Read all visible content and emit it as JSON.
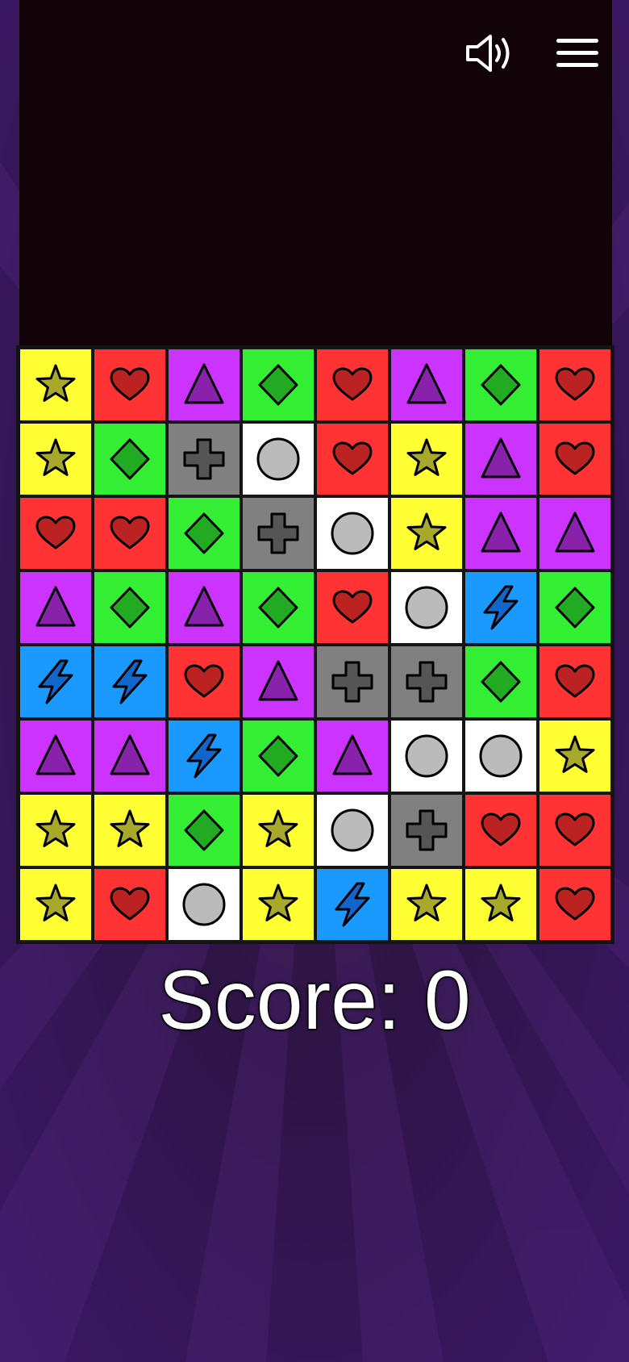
{
  "score": {
    "label": "Score:",
    "value": "0"
  },
  "controls": {
    "sound_icon": "speaker-icon",
    "menu_icon": "hamburger-menu-icon"
  },
  "colors": {
    "star": "#ffff33",
    "heart": "#ff3333",
    "triangle": "#cc33ff",
    "diamond": "#33ee33",
    "plus": "#808080",
    "circle": "#ffffff",
    "bolt": "#1a99ff"
  },
  "board": {
    "rows": 8,
    "cols": 8,
    "grid": [
      [
        "star",
        "heart",
        "triangle",
        "diamond",
        "heart",
        "triangle",
        "diamond",
        "heart"
      ],
      [
        "star",
        "diamond",
        "plus",
        "circle",
        "heart",
        "star",
        "triangle",
        "heart"
      ],
      [
        "heart",
        "heart",
        "diamond",
        "plus",
        "circle",
        "star",
        "triangle",
        "triangle"
      ],
      [
        "triangle",
        "diamond",
        "triangle",
        "diamond",
        "heart",
        "circle",
        "bolt",
        "diamond"
      ],
      [
        "bolt",
        "bolt",
        "heart",
        "triangle",
        "plus",
        "plus",
        "diamond",
        "heart"
      ],
      [
        "triangle",
        "triangle",
        "bolt",
        "diamond",
        "triangle",
        "circle",
        "circle",
        "star"
      ],
      [
        "star",
        "star",
        "diamond",
        "star",
        "circle",
        "plus",
        "heart",
        "heart"
      ],
      [
        "star",
        "heart",
        "circle",
        "star",
        "bolt",
        "star",
        "star",
        "heart"
      ]
    ]
  }
}
